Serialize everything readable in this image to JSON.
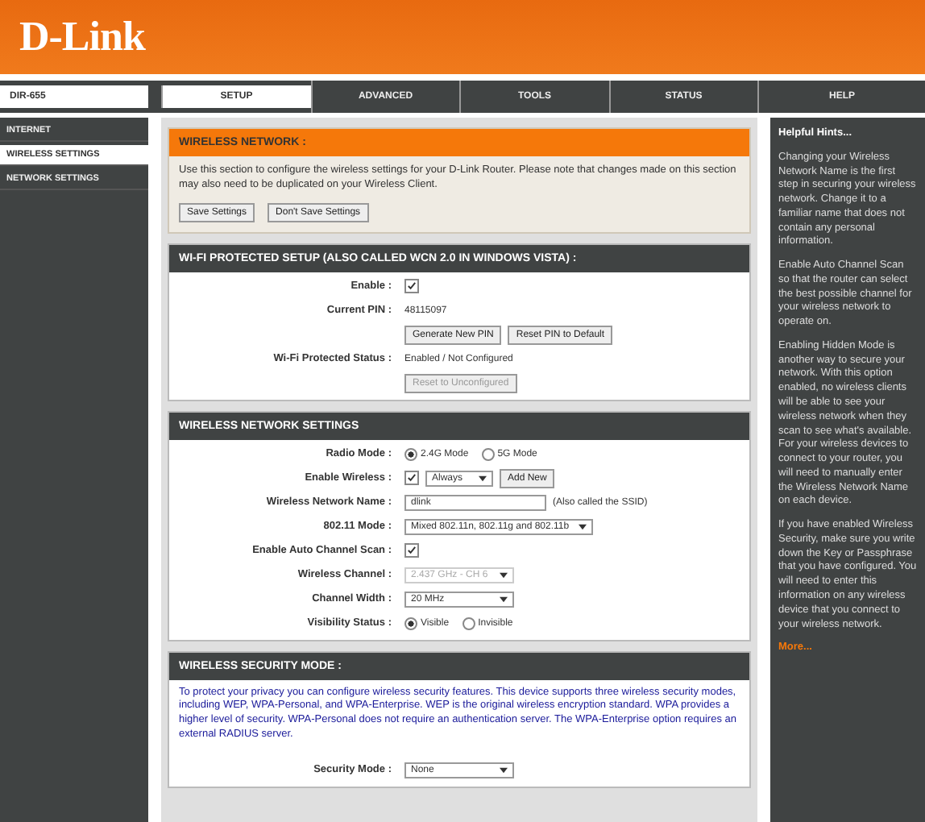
{
  "logo": "D-Link",
  "model": "DIR-655",
  "tabs": [
    {
      "label": "SETUP",
      "selected": true
    },
    {
      "label": "ADVANCED",
      "selected": false
    },
    {
      "label": "TOOLS",
      "selected": false
    },
    {
      "label": "STATUS",
      "selected": false
    },
    {
      "label": "HELP",
      "selected": false
    }
  ],
  "sidebar": {
    "items": [
      {
        "label": "INTERNET",
        "selected": false
      },
      {
        "label": "WIRELESS SETTINGS",
        "selected": true
      },
      {
        "label": "NETWORK SETTINGS",
        "selected": false
      }
    ]
  },
  "intro": {
    "title": "WIRELESS NETWORK :",
    "text": "Use this section to configure the wireless settings for your D-Link Router. Please note that changes made on this section may also need to be duplicated on your Wireless Client.",
    "buttons": [
      "Save Settings",
      "Don't Save Settings"
    ]
  },
  "sections": [
    {
      "title": "WI-FI PROTECTED SETUP (ALSO CALLED WCN 2.0 IN WINDOWS VISTA) :",
      "rows": [
        {
          "kind": "checkbox",
          "label": "Enable :",
          "checked": true
        },
        {
          "kind": "text",
          "label": "Current PIN :",
          "value": "48115097"
        },
        {
          "kind": "buttons",
          "buttons": [
            {
              "label": "Generate New PIN",
              "disabled": false
            },
            {
              "label": "Reset PIN to Default",
              "disabled": false
            }
          ]
        },
        {
          "kind": "text",
          "label": "Wi-Fi Protected Status :",
          "value": "Enabled / Not Configured"
        },
        {
          "kind": "buttons",
          "buttons": [
            {
              "label": "Reset to Unconfigured",
              "disabled": true
            }
          ]
        }
      ]
    },
    {
      "title": "WIRELESS NETWORK SETTINGS",
      "rows": [
        {
          "kind": "radio",
          "label": "Radio Mode :",
          "options": [
            {
              "label": "2.4G Mode",
              "selected": true
            },
            {
              "label": "5G Mode",
              "selected": false
            }
          ]
        },
        {
          "kind": "schedule",
          "label": "Enable Wireless :",
          "checked": true,
          "schedule": "Always",
          "button": "Add New"
        },
        {
          "kind": "input",
          "label": "Wireless Network Name :",
          "value": "dlink",
          "note": "(Also called the SSID)"
        },
        {
          "kind": "select",
          "label": "802.11 Mode :",
          "value": "Mixed 802.11n, 802.11g and 802.11b",
          "disabled": false
        },
        {
          "kind": "checkbox",
          "label": "Enable Auto Channel Scan :",
          "checked": true
        },
        {
          "kind": "select",
          "label": "Wireless Channel :",
          "value": "2.437 GHz - CH 6",
          "disabled": true
        },
        {
          "kind": "select",
          "label": "Channel Width :",
          "value": "20 MHz",
          "disabled": false
        },
        {
          "kind": "radio",
          "label": "Visibility Status :",
          "options": [
            {
              "label": "Visible",
              "selected": true
            },
            {
              "label": "Invisible",
              "selected": false
            }
          ]
        }
      ]
    },
    {
      "title": "WIRELESS SECURITY MODE :",
      "text": "To protect your privacy you can configure wireless security features. This device supports three wireless security modes, including WEP, WPA-Personal, and WPA-Enterprise. WEP is the original wireless encryption standard. WPA provides a higher level of security. WPA-Personal does not require an authentication server. The WPA-Enterprise option requires an external RADIUS server.",
      "rows": [
        {
          "kind": "select",
          "label": "Security Mode :",
          "value": "None",
          "disabled": false
        }
      ]
    }
  ],
  "help": {
    "title": "Helpful Hints...",
    "paragraphs": [
      "Changing your Wireless Network Name is the first step in securing your wireless network. Change it to a familiar name that does not contain any personal information.",
      "Enable Auto Channel Scan so that the router can select the best possible channel for your wireless network to operate on.",
      "Enabling Hidden Mode is another way to secure your network. With this option enabled, no wireless clients will be able to see your wireless network when they scan to see what's available. For your wireless devices to connect to your router, you will need to manually enter the Wireless Network Name on each device.",
      "If you have enabled Wireless Security, make sure you write down the Key or Passphrase that you have configured. You will need to enter this information on any wireless device that you connect to your wireless network."
    ],
    "more": "More..."
  }
}
